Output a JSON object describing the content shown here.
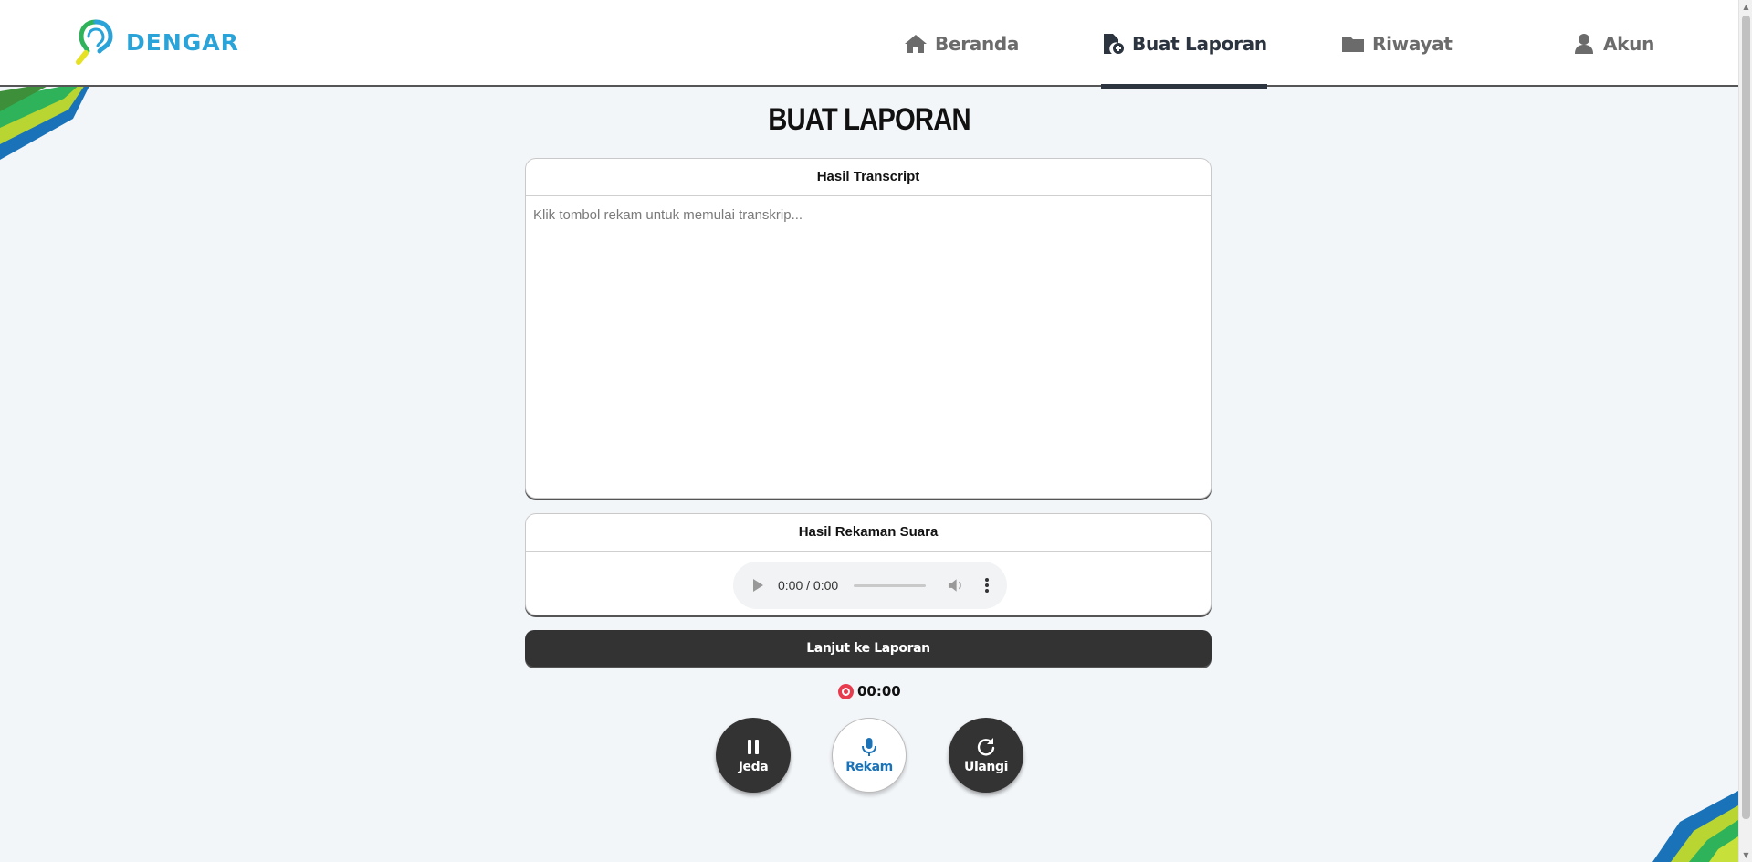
{
  "app": {
    "name": "DENGAR"
  },
  "nav": {
    "items": [
      {
        "label": "Beranda",
        "icon": "home-icon",
        "active": false
      },
      {
        "label": "Buat Laporan",
        "icon": "file-plus-icon",
        "active": true
      },
      {
        "label": "Riwayat",
        "icon": "folder-icon",
        "active": false
      },
      {
        "label": "Akun",
        "icon": "user-icon",
        "active": false
      }
    ]
  },
  "page": {
    "title": "BUAT LAPORAN"
  },
  "transcript": {
    "heading": "Hasil Transcript",
    "placeholder": "Klik tombol rekam untuk memulai transkrip...",
    "value": ""
  },
  "recording": {
    "heading": "Hasil Rekaman Suara",
    "time": "0:00 / 0:00"
  },
  "next_button": {
    "label": "Lanjut ke Laporan"
  },
  "timer": {
    "value": "00:00",
    "icon": "record-icon"
  },
  "controls": {
    "pause": {
      "label": "Jeda",
      "icon": "pause-icon"
    },
    "record": {
      "label": "Rekam",
      "icon": "microphone-icon"
    },
    "reset": {
      "label": "Ulangi",
      "icon": "redo-icon"
    }
  },
  "colors": {
    "brand": "#2aa3d8",
    "dark": "#333333",
    "active_nav": "#2c3440",
    "record_accent": "#1a73b8",
    "record_dot": "#e83b4d"
  }
}
